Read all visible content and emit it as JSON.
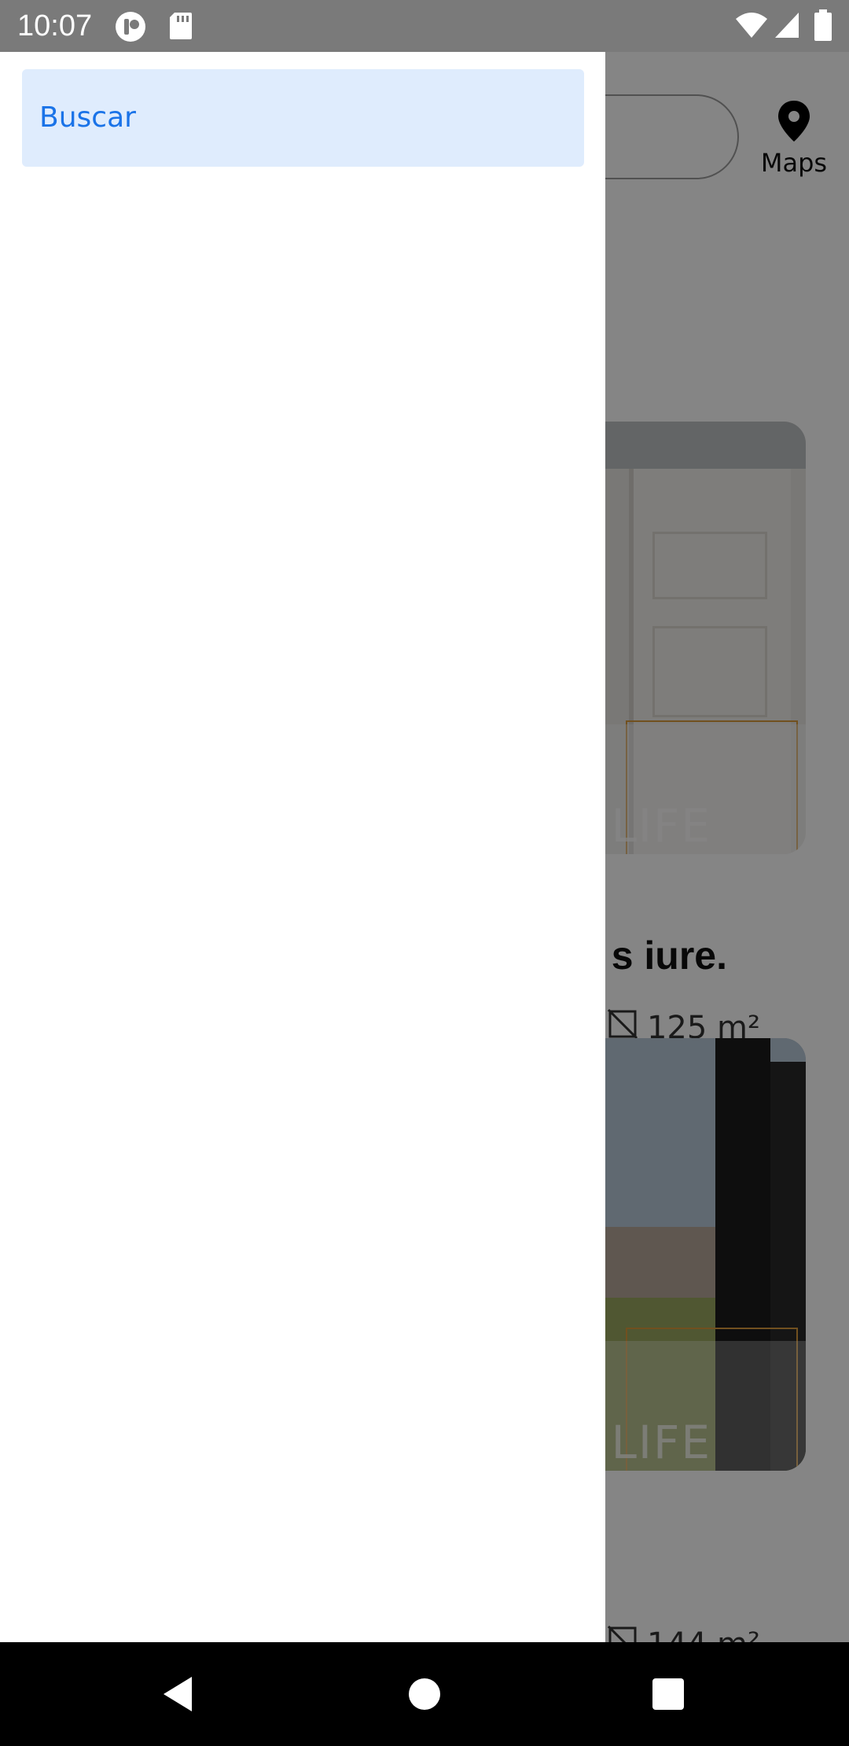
{
  "status_bar": {
    "time": "10:07",
    "icons": [
      "app-notification-icon",
      "sd-card-icon",
      "wifi-icon",
      "signal-icon",
      "battery-icon"
    ]
  },
  "drawer": {
    "items": [
      {
        "label": "Buscar",
        "selected": true
      }
    ],
    "selected_bg": "#dfecfd",
    "accent": "#1a73e8"
  },
  "background": {
    "maps_label": "Maps",
    "listings": [
      {
        "title_fragment": "s iure.",
        "area": "125 m²",
        "watermark": "LIFE"
      },
      {
        "area": "144 m²",
        "watermark": "LIFE"
      }
    ]
  },
  "nav_bar": {
    "buttons": [
      "back-icon",
      "home-icon",
      "recents-icon"
    ]
  }
}
